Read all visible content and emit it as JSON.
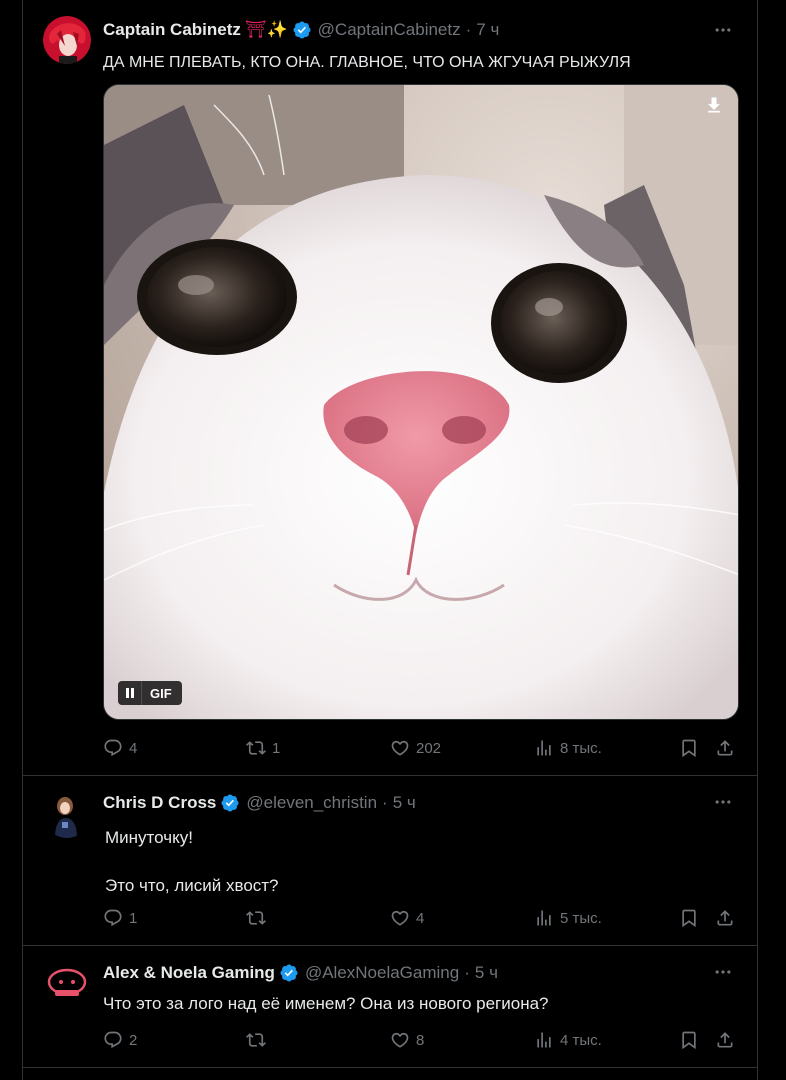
{
  "tweets": [
    {
      "name": "Captain Cabinetz",
      "emoji": "⛩✨",
      "handle": "@CaptainCabinetz",
      "time": "7 ч",
      "text": "ДА МНЕ ПЛЕВАТЬ, КТО ОНА. ГЛАВНОЕ, ЧТО ОНА ЖГУЧАЯ РЫЖУЛЯ",
      "media": {
        "type": "gif",
        "badge": "GIF",
        "icons": [
          "pause-icon",
          "download-icon"
        ]
      },
      "replies": "4",
      "reposts": "1",
      "likes": "202",
      "views": "8 тыс."
    },
    {
      "name": "Chris D Cross",
      "handle": "@eleven_christin",
      "time": "5 ч",
      "text": "Минуточку!\n\nЭто что, лисий хвост?",
      "replies": "1",
      "reposts": "",
      "likes": "4",
      "views": "5 тыс."
    },
    {
      "name": "Alex & Noela Gaming",
      "handle": "@AlexNoelaGaming",
      "time": "5 ч",
      "text": "Что это за лого над её именем? Она из нового региона?",
      "replies": "2",
      "reposts": "",
      "likes": "8",
      "views": "4 тыс."
    }
  ],
  "colors": {
    "background": "#000000",
    "text": "#e7e9ea",
    "muted": "#71767b",
    "verified": "#1d9bf0",
    "border": "#2f3336"
  },
  "icons": [
    "reply-icon",
    "repost-icon",
    "like-icon",
    "views-icon",
    "bookmark-icon",
    "share-icon",
    "more-icon",
    "verified-icon"
  ]
}
